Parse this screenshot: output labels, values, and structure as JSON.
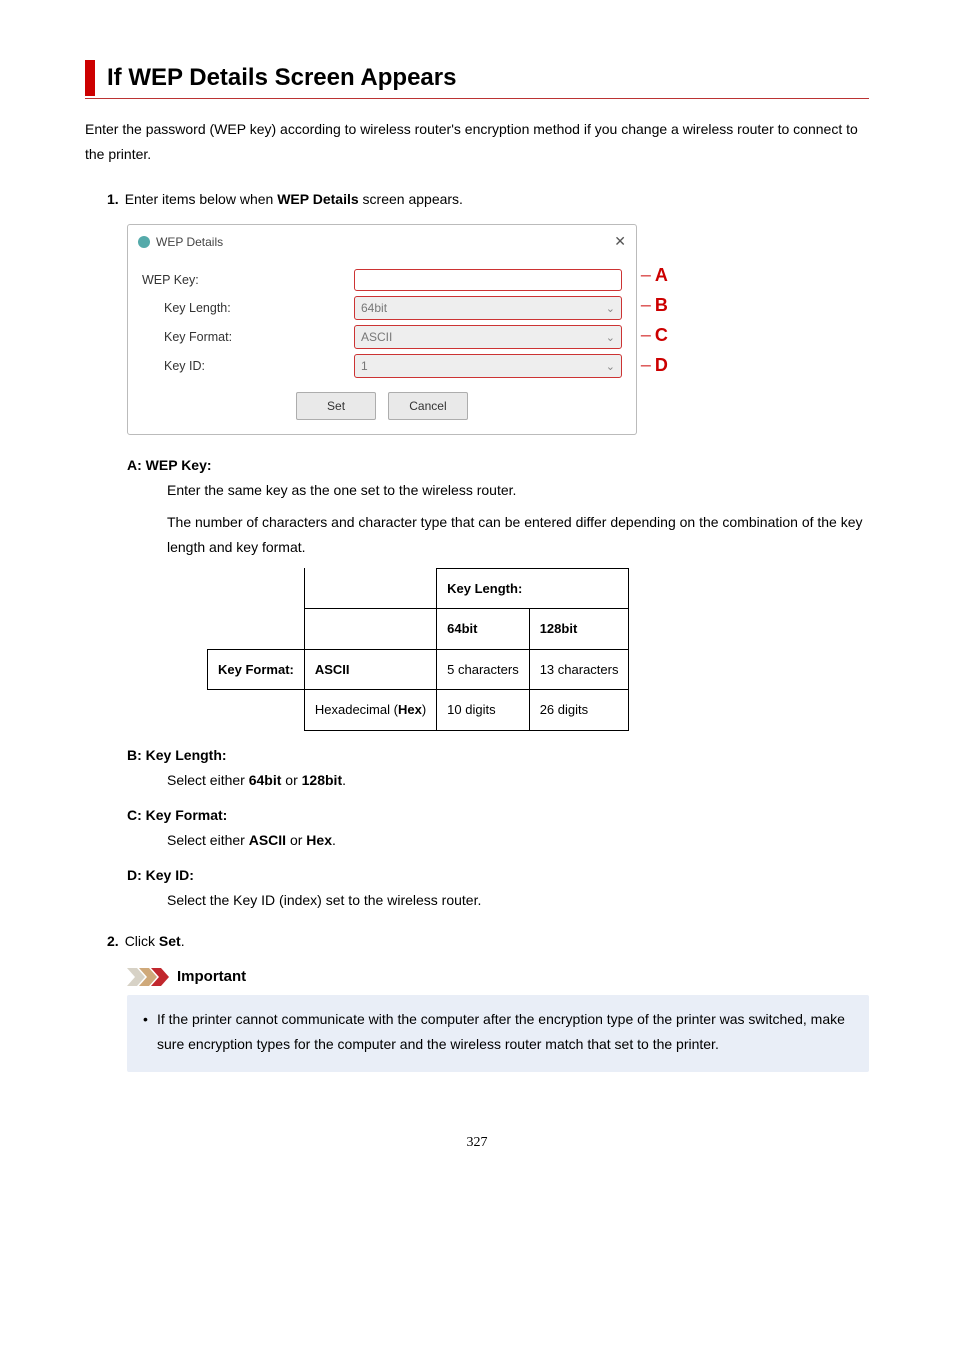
{
  "heading": "If WEP Details Screen Appears",
  "intro": "Enter the password (WEP key) according to wireless router's encryption method if you change a wireless router to connect to the printer.",
  "steps": {
    "s1": {
      "num": "1.",
      "text_before": "Enter items below when ",
      "bold": "WEP Details",
      "text_after": " screen appears."
    },
    "s2": {
      "num": "2.",
      "text_before": "Click ",
      "bold": "Set",
      "text_after": "."
    }
  },
  "dialog": {
    "title": "WEP Details",
    "fields": {
      "wep_key_label": "WEP Key:",
      "key_length_label": "Key Length:",
      "key_length_value": "64bit",
      "key_format_label": "Key Format:",
      "key_format_value": "ASCII",
      "key_id_label": "Key ID:",
      "key_id_value": "1"
    },
    "buttons": {
      "set": "Set",
      "cancel": "Cancel"
    },
    "callouts": {
      "a": "A",
      "b": "B",
      "c": "C",
      "d": "D"
    }
  },
  "defs": {
    "a_term": "A: WEP Key:",
    "a_body1": "Enter the same key as the one set to the wireless router.",
    "a_body2": "The number of characters and character type that can be entered differ depending on the combination of the key length and key format.",
    "b_term": "B: Key Length:",
    "b_body_pre": "Select either ",
    "b_bold1": "64bit",
    "b_mid": " or ",
    "b_bold2": "128bit",
    "b_post": ".",
    "c_term": "C: Key Format:",
    "c_body_pre": "Select either ",
    "c_bold1": "ASCII",
    "c_mid": " or ",
    "c_bold2": "Hex",
    "c_post": ".",
    "d_term": "D: Key ID:",
    "d_body": "Select the Key ID (index) set to the wireless router."
  },
  "table": {
    "head_keylength": "Key Length:",
    "col_64": "64bit",
    "col_128": "128bit",
    "row_keyformat": "Key Format:",
    "ascii": "ASCII",
    "hex_pre": "Hexadecimal (",
    "hex_bold": "Hex",
    "hex_post": ")",
    "v_5": "5 characters",
    "v_13": "13 characters",
    "v_10": "10 digits",
    "v_26": "26 digits"
  },
  "important": {
    "label": "Important",
    "item": "If the printer cannot communicate with the computer after the encryption type of the printer was switched, make sure encryption types for the computer and the wireless router match that set to the printer."
  },
  "page_number": "327"
}
